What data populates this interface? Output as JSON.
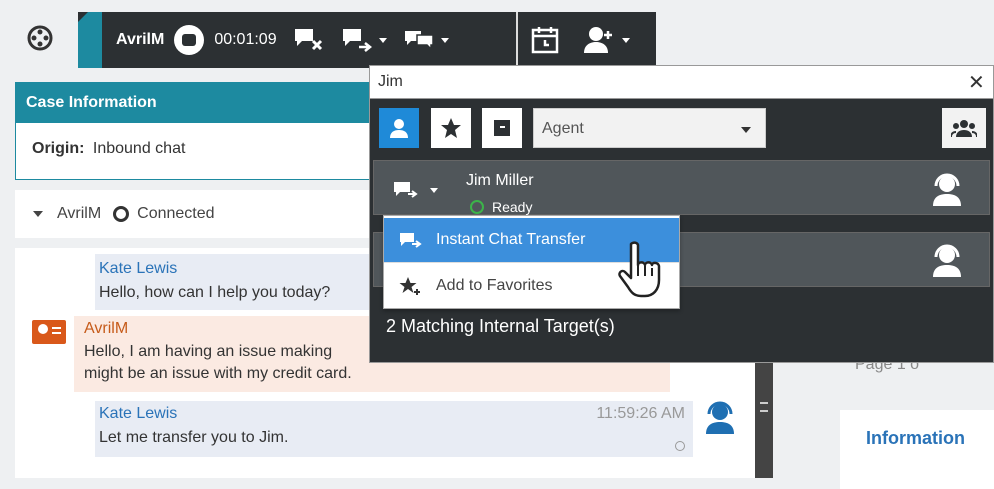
{
  "toolbar": {
    "agent_name": "AvrilM",
    "timer": "00:01:09"
  },
  "case_info": {
    "header": "Case Information",
    "origin_label": "Origin:",
    "origin_value": "Inbound chat"
  },
  "connection": {
    "agent": "AvrilM",
    "status": "Connected"
  },
  "transcript": {
    "messages": [
      {
        "sender": "Kate Lewis",
        "text": "Hello, how can I help you today?",
        "time": ""
      },
      {
        "sender": "AvrilM",
        "text": "Hello, I am having an issue making",
        "text2": "might be an issue with my credit card.",
        "time": ""
      },
      {
        "sender": "Kate Lewis",
        "text": "Let me transfer you to Jim.",
        "time": "11:59:26 AM"
      }
    ]
  },
  "right_pane": {
    "page_text": "Page 1 o",
    "info_title": "Information"
  },
  "transfer": {
    "search_value": "Jim",
    "type_select": "Agent",
    "results": [
      {
        "name": "Jim Miller",
        "status": "Ready"
      }
    ],
    "footer": "2 Matching Internal Target(s)",
    "menu": {
      "items": [
        "Instant Chat Transfer",
        "Add to Favorites"
      ]
    }
  },
  "colors": {
    "teal": "#1d8aa0",
    "dark": "#2c3033",
    "blue_active": "#1f8ad8",
    "menu_highlight": "#3c8fdc",
    "ready_green": "#3cb44a",
    "avril_orange": "#d9581a"
  }
}
